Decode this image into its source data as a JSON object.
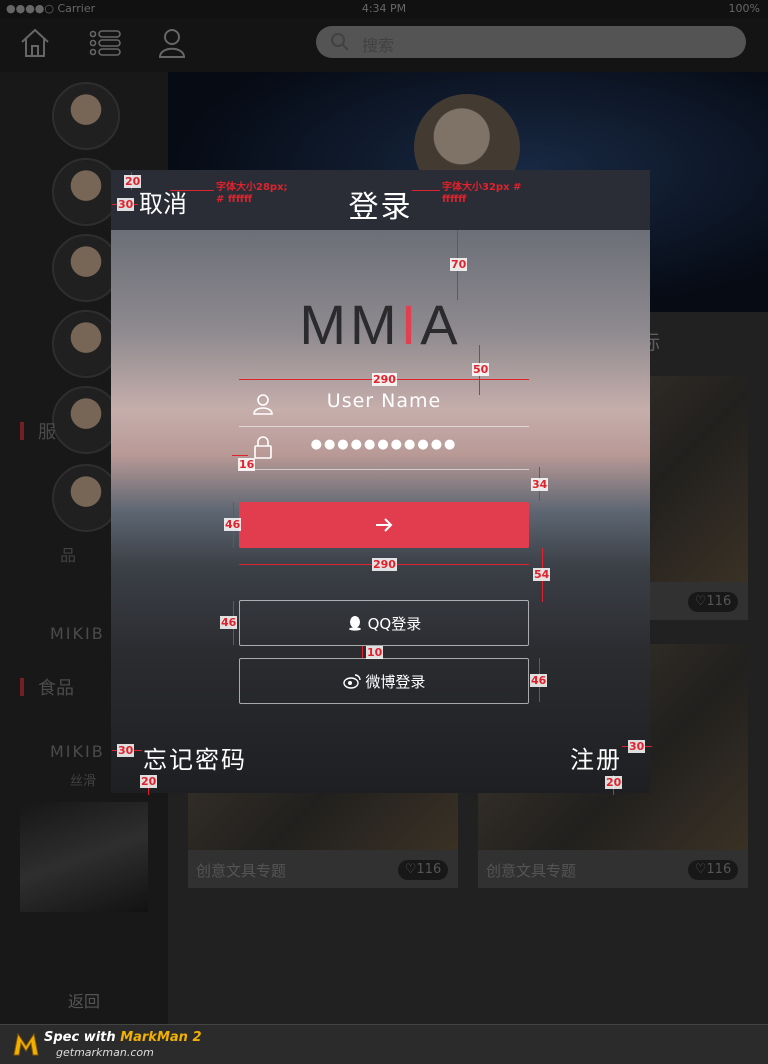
{
  "status_bar": {
    "carrier": "●●●●○ Carrier",
    "time": "4:34 PM",
    "battery": "100%"
  },
  "top_nav": {
    "search_placeholder": "搜索"
  },
  "background": {
    "categories": [
      "服",
      "食品"
    ],
    "brands": [
      "MIKIB",
      "MIKIB"
    ],
    "brand_sub": "丝滑",
    "back_label": "返回",
    "card_caption": "创意文具专题",
    "like_count": "116",
    "partial_label_1": "品",
    "partial_label_2": "标"
  },
  "modal": {
    "cancel_label": "取消",
    "title": "登录",
    "logo_left": "MM",
    "logo_red": "I",
    "logo_right": "A",
    "username_value": "User Name",
    "password_value": "●●●●●●●●●●●",
    "submit_icon": "arrow-right-icon",
    "qq_login_label": "QQ登录",
    "weibo_login_label": "微博登录",
    "forgot_label": "忘记密码",
    "register_label": "注册"
  },
  "annotations": {
    "cancel_font_note_1": "字体大小28px;",
    "cancel_font_note_2": "# ffffff",
    "title_font_note_1": "字体大小32px #",
    "title_font_note_2": "ffffff",
    "m20_top": "20",
    "m30_left": "30",
    "m70": "70",
    "m50": "50",
    "w290_top": "290",
    "m16": "16",
    "m34": "34",
    "h46_submit": "46",
    "w290_bottom": "290",
    "m54": "54",
    "h46_qq": "46",
    "m10": "10",
    "h46_weibo": "46",
    "m30_forgot": "30",
    "m20_forgot": "20",
    "m30_register": "30",
    "m20_register": "20"
  },
  "markman": {
    "label_prefix": "Spec with ",
    "label_brand": "MarkMan 2",
    "url": "getmarkman.com"
  },
  "colors": {
    "accent": "#e23d4e",
    "header": "#2a2d36",
    "annotation": "#e0222c"
  }
}
